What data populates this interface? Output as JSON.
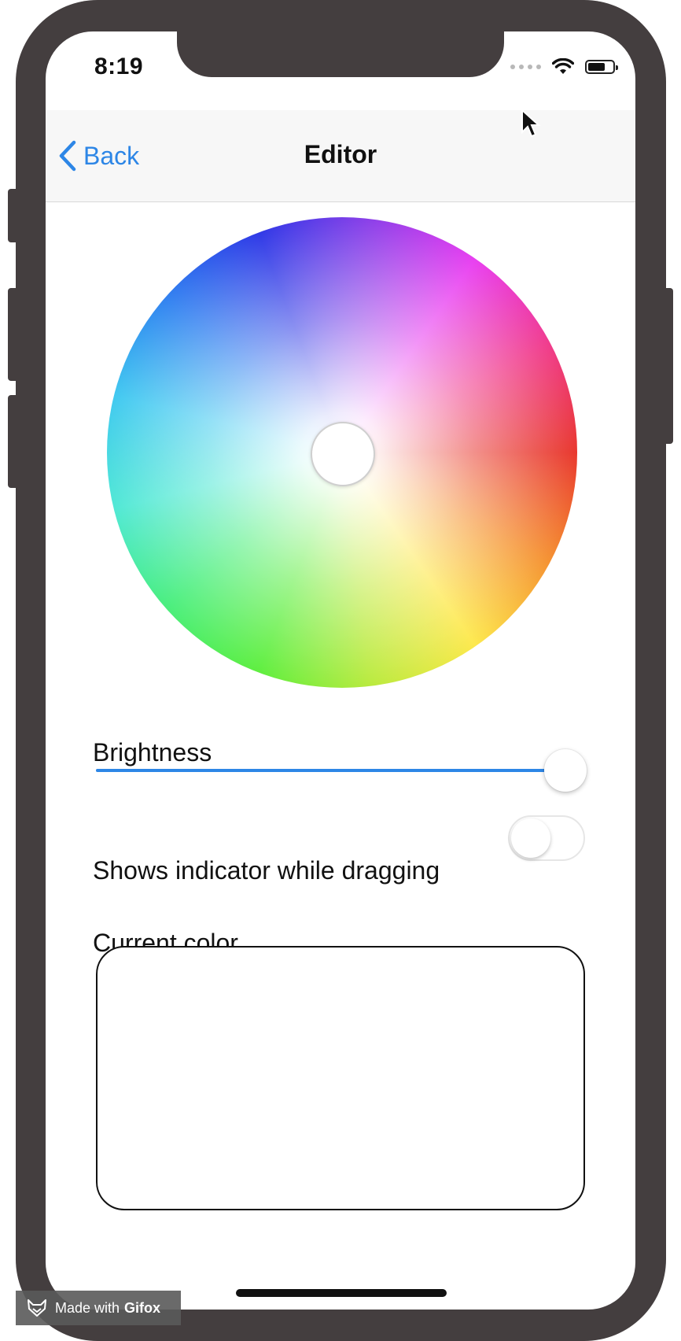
{
  "status_bar": {
    "time": "8:19"
  },
  "navbar": {
    "back_label": "Back",
    "title": "Editor"
  },
  "brightness": {
    "label": "Brightness",
    "value": 0.95
  },
  "indicator_toggle": {
    "label": "Shows indicator while dragging",
    "on": false
  },
  "current_color": {
    "label": "Current color",
    "value": "#ffffff"
  },
  "watermark": {
    "prefix": "Made with",
    "brand": "Gifox"
  },
  "colors": {
    "accent": "#2d86e6",
    "frame": "#443e3f"
  }
}
